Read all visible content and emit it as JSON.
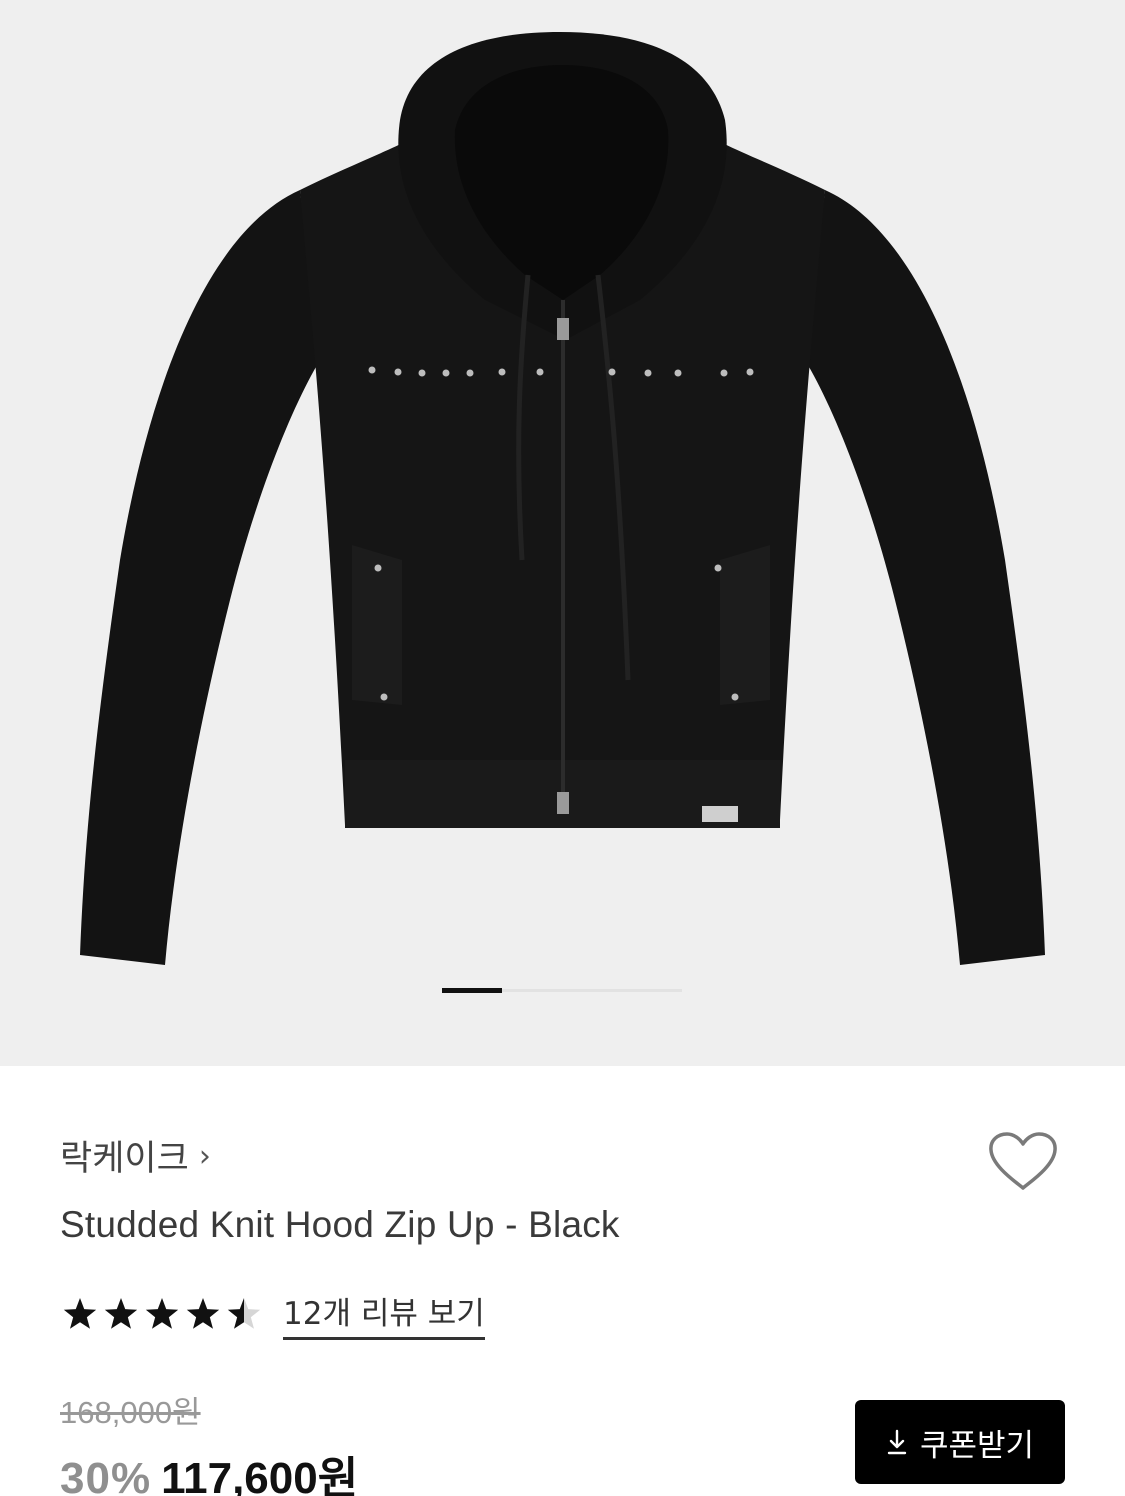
{
  "product": {
    "brand": "락케이크",
    "brand_chevron": "›",
    "title": "Studded Knit Hood Zip Up - Black",
    "rating": 4.5,
    "rating_max": 5,
    "reviews_label": "12개 리뷰 보기",
    "original_price": "168,000원",
    "discount": "30%",
    "price": "117,600원",
    "coupon_label": "쿠폰받기"
  },
  "gallery": {
    "current_slide": 1,
    "slide_count": 4
  },
  "icons": {
    "brand_link": "chevron-right-icon",
    "wishlist": "heart-outline-icon",
    "coupon": "download-icon",
    "rating": "star-icon"
  },
  "colors": {
    "gallery_bg": "#efefef",
    "garment": "#121212",
    "accent": "#000000",
    "discount": "#8f8f8f"
  }
}
